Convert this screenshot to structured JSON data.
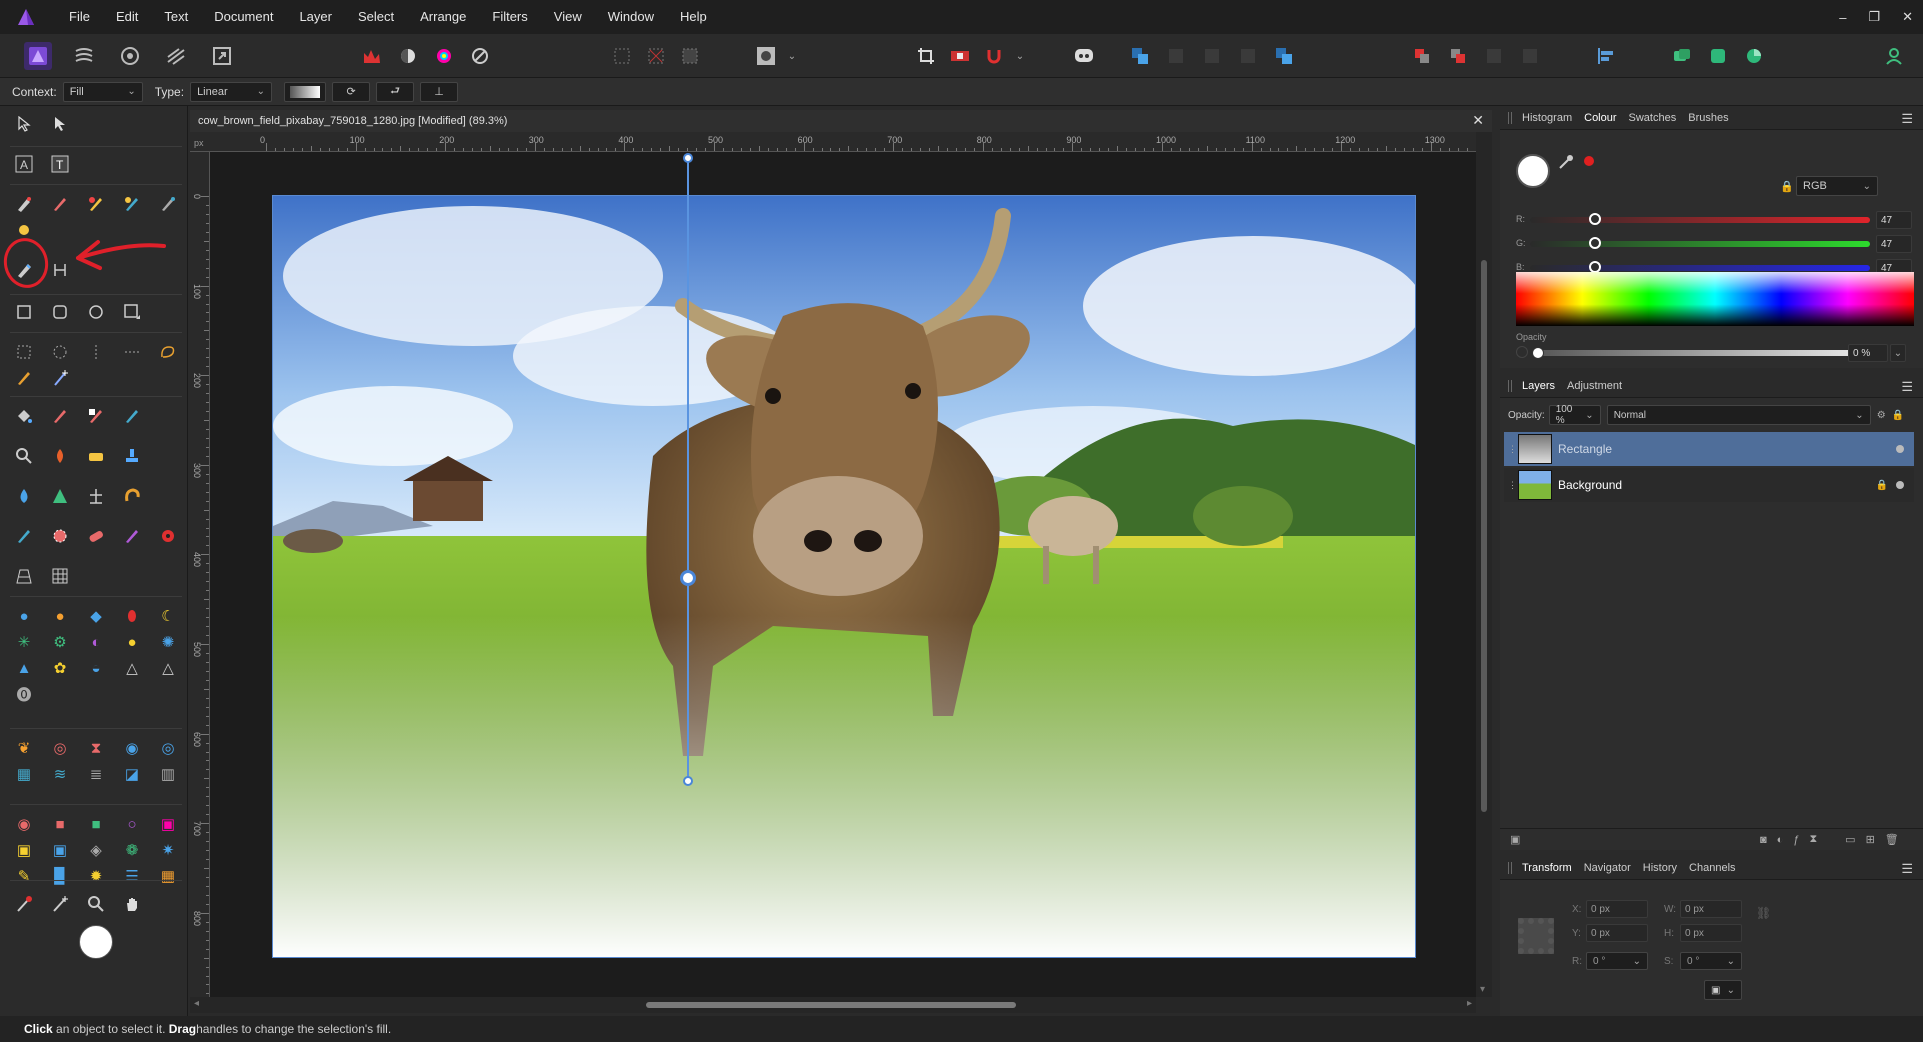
{
  "menubar": {
    "items": [
      "File",
      "Edit",
      "Text",
      "Document",
      "Layer",
      "Select",
      "Arrange",
      "Filters",
      "View",
      "Window",
      "Help"
    ],
    "window_controls": [
      "–",
      "❐",
      "✕"
    ]
  },
  "context": {
    "context_label": "Context:",
    "context_value": "Fill",
    "type_label": "Type:",
    "type_value": "Linear"
  },
  "document": {
    "title": "cow_brown_field_pixabay_759018_1280.jpg [Modified] (89.3%)",
    "close": "✕",
    "ruler_unit": "px",
    "h_ticks": [
      "0",
      "100",
      "200",
      "300",
      "400",
      "500",
      "600",
      "700",
      "800",
      "900",
      "1000",
      "1100",
      "1200",
      "1300"
    ],
    "v_ticks": [
      "0",
      "100",
      "200",
      "300",
      "400",
      "500",
      "600",
      "700",
      "800"
    ]
  },
  "colour_panel": {
    "tabs": [
      "Histogram",
      "Colour",
      "Swatches",
      "Brushes"
    ],
    "active_tab": "Colour",
    "mode": "RGB",
    "channels": [
      {
        "label": "R:",
        "value": "47",
        "color": "#e0242b"
      },
      {
        "label": "G:",
        "value": "47",
        "color": "#2ddb2d"
      },
      {
        "label": "B:",
        "value": "47",
        "color": "#2626e8"
      }
    ],
    "opacity_label": "Opacity",
    "opacity_value": "0 %"
  },
  "layers_panel": {
    "tabs": [
      "Layers",
      "Adjustment"
    ],
    "active_tab": "Layers",
    "opacity_label": "Opacity:",
    "opacity_value": "100 %",
    "blend_mode": "Normal",
    "layers": [
      {
        "name": "Rectangle",
        "selected": true
      },
      {
        "name": "Background",
        "selected": false
      }
    ]
  },
  "transform_panel": {
    "tabs": [
      "Transform",
      "Navigator",
      "History",
      "Channels"
    ],
    "active_tab": "Transform",
    "x_label": "X:",
    "x_value": "0 px",
    "y_label": "Y:",
    "y_value": "0 px",
    "w_label": "W:",
    "w_value": "0 px",
    "h_label": "H:",
    "h_value": "0 px",
    "r_label": "R:",
    "r_value": "0 °",
    "s_label": "S:",
    "s_value": "0 °"
  },
  "status": {
    "click": "Click",
    "text1": " an object to select it. ",
    "drag": "Drag",
    "text2": " handles to change the selection's fill."
  },
  "colors": {
    "accent": "#4f6e9a",
    "annotation": "#e0202a"
  }
}
